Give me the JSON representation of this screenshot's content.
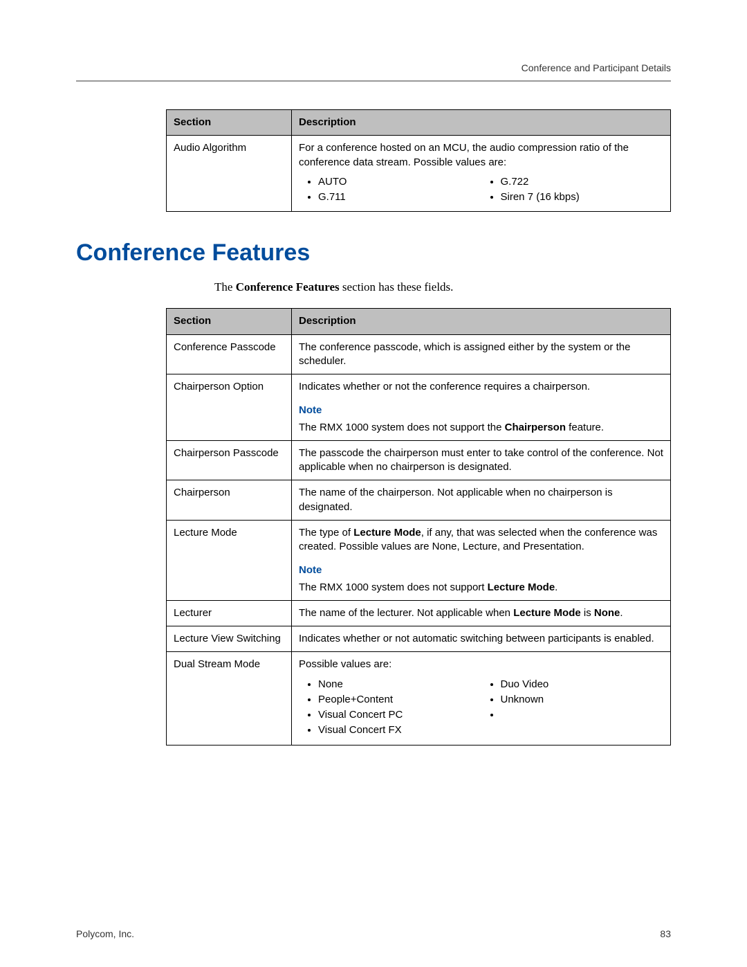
{
  "running_head": "Conference and Participant Details",
  "footer": {
    "company": "Polycom, Inc.",
    "page": "83"
  },
  "table1": {
    "headers": {
      "section": "Section",
      "description": "Description"
    },
    "row": {
      "section": "Audio Algorithm",
      "desc": "For a conference hosted on an MCU, the audio compression ratio of the conference data stream. Possible values are:",
      "bullets_left": [
        "AUTO",
        "G.711"
      ],
      "bullets_right": [
        "G.722",
        "Siren 7 (16 kbps)"
      ]
    }
  },
  "heading": "Conference Features",
  "intro_pre": "The ",
  "intro_bold": "Conference Features",
  "intro_post": " section has these fields.",
  "table2": {
    "headers": {
      "section": "Section",
      "description": "Description"
    },
    "rows": {
      "conf_passcode": {
        "section": "Conference Passcode",
        "desc": "The conference passcode, which is assigned either by the system or the scheduler."
      },
      "chair_option": {
        "section": "Chairperson Option",
        "desc": "Indicates whether or not the conference requires a chairperson.",
        "note_label": "Note",
        "note_pre": "The RMX 1000 system does not support the ",
        "note_bold": "Chairperson",
        "note_post": " feature."
      },
      "chair_passcode": {
        "section": "Chairperson Passcode",
        "desc": "The passcode the chairperson must enter to take control of the conference. Not applicable when no chairperson is designated."
      },
      "chairperson": {
        "section": "Chairperson",
        "desc": "The name of the chairperson. Not applicable when no chairperson is designated."
      },
      "lecture_mode": {
        "section": "Lecture Mode",
        "desc_pre": "The type of ",
        "desc_bold": "Lecture Mode",
        "desc_post": ", if any, that was selected when the conference was created. Possible values are None, Lecture, and Presentation.",
        "note_label": "Note",
        "note_pre": "The RMX 1000 system does not support ",
        "note_bold": "Lecture Mode",
        "note_post": "."
      },
      "lecturer": {
        "section": "Lecturer",
        "desc_pre": "The name of the lecturer. Not applicable when ",
        "desc_bold1": "Lecture Mode",
        "desc_mid": " is ",
        "desc_bold2": "None",
        "desc_post": "."
      },
      "lecture_view": {
        "section": "Lecture View Switching",
        "desc": "Indicates whether or not automatic switching between participants is enabled."
      },
      "dual_stream": {
        "section": "Dual Stream Mode",
        "desc": "Possible values are:",
        "bullets_left": [
          "None",
          "People+Content",
          "Visual Concert PC",
          "Visual Concert FX"
        ],
        "bullets_right": [
          "Duo Video",
          "Unknown",
          ""
        ]
      }
    }
  }
}
